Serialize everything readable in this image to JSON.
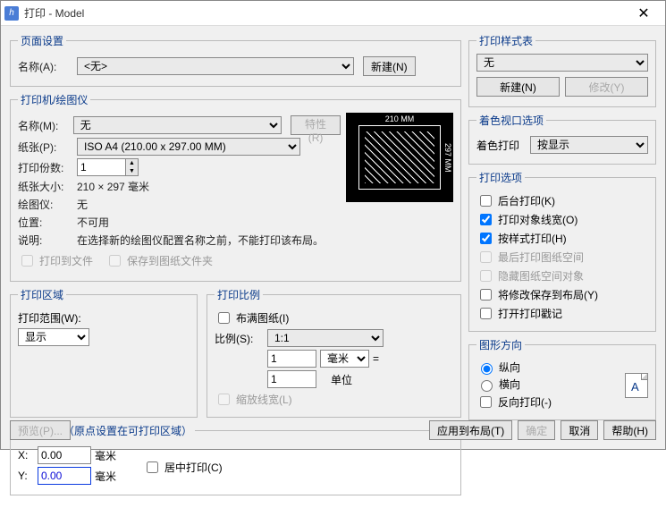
{
  "window": {
    "title": "打印 - Model"
  },
  "page_setup": {
    "legend": "页面设置",
    "name_label": "名称(A):",
    "name_value": "<无>",
    "new_btn": "新建(N)"
  },
  "printer": {
    "legend": "打印机/绘图仪",
    "name_label": "名称(M):",
    "name_value": "无",
    "props_btn": "特性(R)",
    "paper_label": "纸张(P):",
    "paper_value": "ISO A4 (210.00 x 297.00 MM)",
    "copies_label": "打印份数:",
    "copies_value": "1",
    "size_label": "纸张大小:",
    "size_value": "210 × 297  毫米",
    "plotter_label": "绘图仪:",
    "plotter_value": "无",
    "location_label": "位置:",
    "location_value": "不可用",
    "desc_label": "说明:",
    "desc_value": "在选择新的绘图仪配置名称之前，不能打印该布局。",
    "to_file": "打印到文件",
    "save_to_drawing": "保存到图纸文件夹",
    "dim_top": "210 MM",
    "dim_right": "297 MM"
  },
  "area": {
    "legend": "打印区域",
    "range_label": "打印范围(W):",
    "range_value": "显示"
  },
  "scale": {
    "legend": "打印比例",
    "fit": "布满图纸(I)",
    "ratio_label": "比例(S):",
    "ratio_value": "1:1",
    "num1": "1",
    "unit_sel": "毫米",
    "eq": "=",
    "num2": "1",
    "units_label": "单位",
    "scale_lw": "缩放线宽(L)"
  },
  "offset": {
    "legend": "打印偏移（原点设置在可打印区域）",
    "x_label": "X:",
    "x_value": "0.00",
    "x_unit": "毫米",
    "y_label": "Y:",
    "y_value": "0.00",
    "y_unit": "毫米",
    "center": "居中打印(C)"
  },
  "style": {
    "legend": "打印样式表",
    "value": "无",
    "new_btn": "新建(N)",
    "edit_btn": "修改(Y)"
  },
  "shade": {
    "legend": "着色视口选项",
    "label": "着色打印",
    "value": "按显示"
  },
  "options": {
    "legend": "打印选项",
    "background": "后台打印(K)",
    "lineweight": "打印对象线宽(O)",
    "bystyle": "按样式打印(H)",
    "paperspace_last": "最后打印图纸空间",
    "hide_paperspace": "隐藏图纸空间对象",
    "save_layout": "将修改保存到布局(Y)",
    "stamp": "打开打印戳记"
  },
  "orient": {
    "legend": "图形方向",
    "portrait": "纵向",
    "landscape": "横向",
    "reverse": "反向打印(-)"
  },
  "footer": {
    "preview": "预览(P)...",
    "apply": "应用到布局(T)",
    "ok": "确定",
    "cancel": "取消",
    "help": "帮助(H)"
  }
}
